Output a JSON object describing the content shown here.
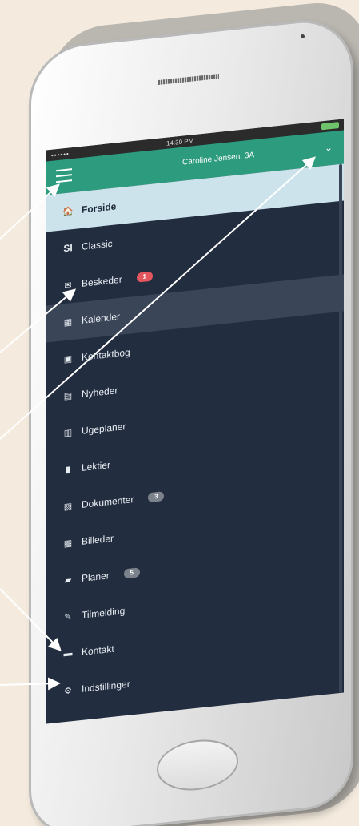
{
  "status": {
    "signal": "••••••",
    "time": "14:30 PM"
  },
  "header": {
    "user": "Caroline Jensen, 3A",
    "menu_icon": "hamburger-menu-icon",
    "dropdown_icon": "chevron-down-icon"
  },
  "menu": {
    "items": [
      {
        "label": "Forside",
        "icon": "home-icon",
        "glyph": "🏠",
        "badge": ""
      },
      {
        "label": "Classic",
        "icon": "si-logo-icon",
        "glyph": "SI",
        "badge": ""
      },
      {
        "label": "Beskeder",
        "icon": "mail-icon",
        "glyph": "✉",
        "badge": "1"
      },
      {
        "label": "Kalender",
        "icon": "calendar-icon",
        "glyph": "▦",
        "badge": ""
      },
      {
        "label": "Kontaktbog",
        "icon": "contact-book-icon",
        "glyph": "▣",
        "badge": ""
      },
      {
        "label": "Nyheder",
        "icon": "news-icon",
        "glyph": "▤",
        "badge": ""
      },
      {
        "label": "Ugeplaner",
        "icon": "week-plan-icon",
        "glyph": "▥",
        "badge": ""
      },
      {
        "label": "Lektier",
        "icon": "homework-icon",
        "glyph": "▮",
        "badge": ""
      },
      {
        "label": "Dokumenter",
        "icon": "document-icon",
        "glyph": "▧",
        "badge": "3"
      },
      {
        "label": "Billeder",
        "icon": "images-icon",
        "glyph": "▩",
        "badge": ""
      },
      {
        "label": "Planer",
        "icon": "plans-icon",
        "glyph": "▰",
        "badge": "5"
      },
      {
        "label": "Tilmelding",
        "icon": "signup-icon",
        "glyph": "✎",
        "badge": ""
      },
      {
        "label": "Kontakt",
        "icon": "contact-icon",
        "glyph": "▬",
        "badge": ""
      },
      {
        "label": "Indstillinger",
        "icon": "gear-icon",
        "glyph": "⚙",
        "badge": ""
      }
    ]
  },
  "colors": {
    "header": "#2d9b7d",
    "menu_background": "#232d40",
    "active_item": "#cde3ec",
    "badge_red": "#e2565d",
    "badge_gray": "#7b828c"
  }
}
